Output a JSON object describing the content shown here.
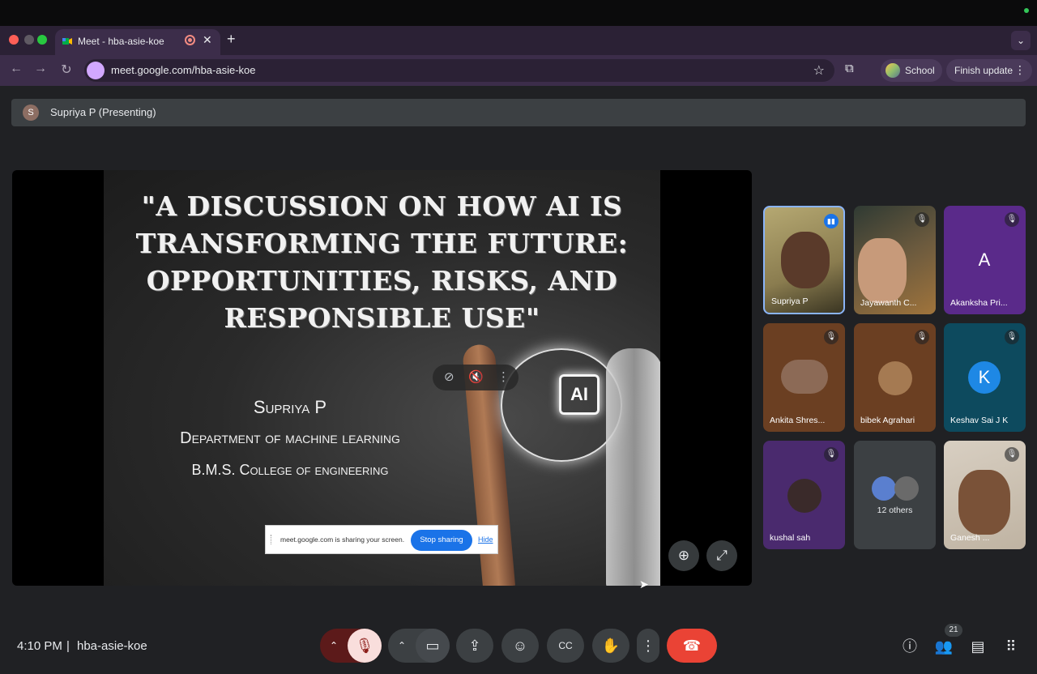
{
  "browser": {
    "tab_title": "Meet - hba-asie-koe",
    "tab_close": "✕",
    "new_tab": "+",
    "url": "meet.google.com/hba-asie-koe",
    "profile_label": "School",
    "finish_update_label": "Finish update",
    "colors": {
      "tabbar": "#2b2135",
      "toolbar": "#3c2d4a",
      "red": "#ff5f57",
      "yellow": "#febc2e",
      "green": "#28c840"
    }
  },
  "presenting": {
    "avatar_initial": "S",
    "label": "Supriya P (Presenting)"
  },
  "slide": {
    "title_line1": "\"A discussion on how AI is",
    "title_line2": "transforming the future:",
    "title_line3": "opportunities, risks, and",
    "title_line4": "responsible use\"",
    "presenter": "Supriya P",
    "department": "Department of machine learning",
    "college": "B.M.S. College of engineering",
    "chip_text": "AI"
  },
  "share_notice": {
    "message": "meet.google.com is sharing your screen.",
    "stop_label": "Stop sharing",
    "hide_label": "Hide"
  },
  "participants": [
    {
      "name": "Supriya P",
      "speaking": true
    },
    {
      "name": "Jayawanth C...",
      "muted": true
    },
    {
      "name": "Akanksha Pri...",
      "initial": "A",
      "muted": true,
      "color": "#7b1fa2"
    },
    {
      "name": "Ankita Shres...",
      "muted": true
    },
    {
      "name": "bibek Agrahari",
      "muted": true
    },
    {
      "name": "Keshav Sai J K",
      "initial": "K",
      "muted": true,
      "color": "#1565c0"
    },
    {
      "name": "kushal sah",
      "muted": true
    },
    {
      "name": "12 others"
    },
    {
      "name": "Ganesh ...",
      "muted": true
    }
  ],
  "bottom_bar": {
    "time": "4:10 PM",
    "separator": "|",
    "meeting_code": "hba-asie-koe",
    "participant_count": "21"
  },
  "icons": [
    "mic-off-icon",
    "camera-icon",
    "present-icon",
    "emoji-icon",
    "captions-icon",
    "raise-hand-icon",
    "more-icon",
    "end-call-icon",
    "info-icon",
    "people-icon",
    "chat-icon",
    "apps-icon",
    "zoom-icon",
    "fullscreen-icon"
  ]
}
